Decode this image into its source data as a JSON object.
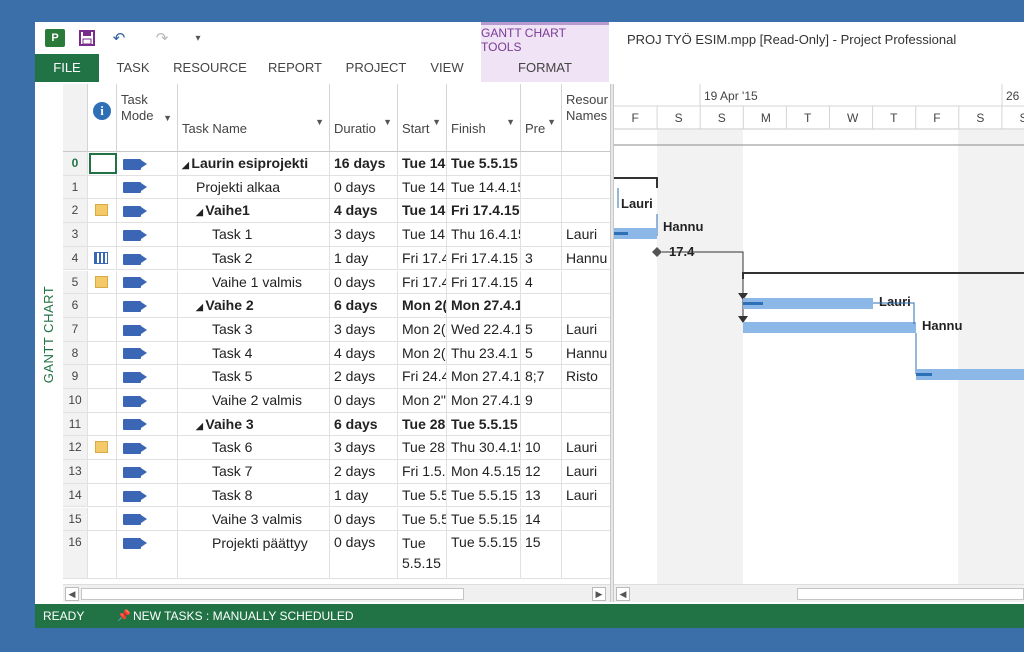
{
  "window": {
    "title": "PROJ TYÖ ESIM.mpp [Read-Only] - Project Professional",
    "context_tab_group": "GANTT CHART TOOLS",
    "view_label": "GANTT CHART"
  },
  "qat": {
    "app": "P",
    "save": "💾",
    "undo": "↶",
    "redo": "↷",
    "customize": "▾"
  },
  "ribbon_tabs": [
    {
      "label": "FILE"
    },
    {
      "label": "TASK"
    },
    {
      "label": "RESOURCE"
    },
    {
      "label": "REPORT"
    },
    {
      "label": "PROJECT"
    },
    {
      "label": "VIEW"
    },
    {
      "label": "FORMAT"
    }
  ],
  "columns": {
    "info": "i",
    "mode": "Task Mode",
    "name": "Task Name",
    "duration": "Duratio",
    "start": "Start",
    "finish": "Finish",
    "pred": "Pre",
    "res": "Resour Names"
  },
  "rows": [
    {
      "id": "0",
      "ind": "",
      "name": "Laurin esiprojekti",
      "dur": "16 days",
      "start": "Tue 14",
      "finish": "Tue 5.5.15",
      "pred": "",
      "res": "",
      "bold": true,
      "level": 0,
      "collapse": true
    },
    {
      "id": "1",
      "ind": "",
      "name": "Projekti alkaa",
      "dur": "0 days",
      "start": "Tue 14",
      "finish": "Tue 14.4.15",
      "pred": "",
      "res": "",
      "bold": false,
      "level": 1
    },
    {
      "id": "2",
      "ind": "note",
      "name": "Vaihe1",
      "dur": "4 days",
      "start": "Tue 14",
      "finish": "Fri 17.4.15",
      "pred": "",
      "res": "",
      "bold": true,
      "level": 1,
      "collapse": true
    },
    {
      "id": "3",
      "ind": "",
      "name": "Task 1",
      "dur": "3 days",
      "start": "Tue 14",
      "finish": "Thu 16.4.15",
      "pred": "",
      "res": "Lauri",
      "bold": false,
      "level": 2
    },
    {
      "id": "4",
      "ind": "cal",
      "name": "Task 2",
      "dur": "1 day",
      "start": "Fri 17.4",
      "finish": "Fri 17.4.15",
      "pred": "3",
      "res": "Hannu",
      "bold": false,
      "level": 2
    },
    {
      "id": "5",
      "ind": "note",
      "name": "Vaihe 1 valmis",
      "dur": "0 days",
      "start": "Fri 17.4",
      "finish": "Fri 17.4.15",
      "pred": "4",
      "res": "",
      "bold": false,
      "level": 2
    },
    {
      "id": "6",
      "ind": "",
      "name": "Vaihe 2",
      "dur": "6 days",
      "start": "Mon 2(",
      "finish": "Mon 27.4.1",
      "pred": "",
      "res": "",
      "bold": true,
      "level": 1,
      "collapse": true
    },
    {
      "id": "7",
      "ind": "",
      "name": "Task 3",
      "dur": "3 days",
      "start": "Mon 2(",
      "finish": "Wed 22.4.1",
      "pred": "5",
      "res": "Lauri",
      "bold": false,
      "level": 2
    },
    {
      "id": "8",
      "ind": "",
      "name": "Task 4",
      "dur": "4 days",
      "start": "Mon 2(",
      "finish": "Thu 23.4.1",
      "pred": "5",
      "res": "Hannu",
      "bold": false,
      "level": 2
    },
    {
      "id": "9",
      "ind": "",
      "name": "Task 5",
      "dur": "2 days",
      "start": "Fri 24.4",
      "finish": "Mon 27.4.1",
      "pred": "8;7",
      "res": "Risto",
      "bold": false,
      "level": 2
    },
    {
      "id": "10",
      "ind": "",
      "name": "Vaihe 2 valmis",
      "dur": "0 days",
      "start": "Mon 2\"",
      "finish": "Mon 27.4.1",
      "pred": "9",
      "res": "",
      "bold": false,
      "level": 2
    },
    {
      "id": "11",
      "ind": "",
      "name": "Vaihe 3",
      "dur": "6 days",
      "start": "Tue 28",
      "finish": "Tue 5.5.15",
      "pred": "",
      "res": "",
      "bold": true,
      "level": 1,
      "collapse": true
    },
    {
      "id": "12",
      "ind": "note",
      "name": "Task 6",
      "dur": "3 days",
      "start": "Tue 28",
      "finish": "Thu 30.4.15",
      "pred": "10",
      "res": "Lauri",
      "bold": false,
      "level": 2
    },
    {
      "id": "13",
      "ind": "",
      "name": "Task 7",
      "dur": "2 days",
      "start": "Fri 1.5.",
      "finish": "Mon 4.5.15",
      "pred": "12",
      "res": "Lauri",
      "bold": false,
      "level": 2
    },
    {
      "id": "14",
      "ind": "",
      "name": "Task 8",
      "dur": "1 day",
      "start": "Tue 5.5",
      "finish": "Tue 5.5.15",
      "pred": "13",
      "res": "Lauri",
      "bold": false,
      "level": 2
    },
    {
      "id": "15",
      "ind": "",
      "name": "Vaihe 3 valmis",
      "dur": "0 days",
      "start": "Tue 5.5",
      "finish": "Tue 5.5.15",
      "pred": "14",
      "res": "",
      "bold": false,
      "level": 2
    },
    {
      "id": "16",
      "ind": "",
      "name": "Projekti päättyy",
      "dur": "0 days",
      "start": "Tue 5.5.15",
      "finish": "Tue 5.5.15",
      "pred": "15",
      "res": "",
      "bold": false,
      "level": 2
    }
  ],
  "timescale": {
    "weeks": [
      "19 Apr '15",
      "26"
    ],
    "days": [
      "F",
      "S",
      "S",
      "M",
      "T",
      "W",
      "T",
      "F",
      "S",
      "S"
    ]
  },
  "gantt": {
    "labels": [
      "Lauri",
      "Hannu",
      "17.4",
      "Lauri",
      "Hannu"
    ]
  },
  "status": {
    "ready": "READY",
    "new_tasks": "NEW TASKS : MANUALLY SCHEDULED",
    "pin": "📌"
  },
  "colors": {
    "accent": "#217346",
    "bar": "#8cb8e8",
    "context": "#efe3f5"
  }
}
